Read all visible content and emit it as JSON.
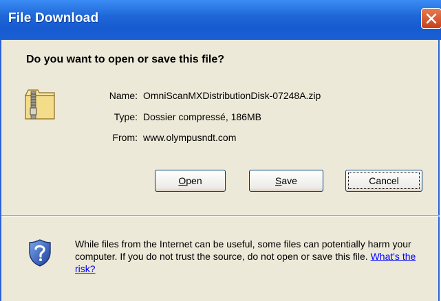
{
  "window": {
    "title": "File Download"
  },
  "dialog": {
    "question": "Do you want to open or save this file?",
    "name_label": "Name:",
    "name_value": "OmniScanMXDistributionDisk-07248A.zip",
    "type_label": "Type:",
    "type_value": "Dossier compressé, 186MB",
    "from_label": "From:",
    "from_value": "www.olympusndt.com"
  },
  "buttons": {
    "open": {
      "mnemonic": "O",
      "rest": "pen"
    },
    "save": {
      "mnemonic": "S",
      "rest": "ave"
    },
    "cancel": "Cancel"
  },
  "warning": {
    "text": "While files from the Internet can be useful, some files can potentially harm your computer. If you do not trust the source, do not open or save this file.",
    "link": "What's the risk?"
  },
  "icons": {
    "file": "zip-folder-icon",
    "security": "shield-question-icon",
    "close": "close-icon"
  },
  "colors": {
    "titlebar": "#1f67d8",
    "close_button": "#d4572a",
    "dialog_background": "#ece9d8",
    "link": "#0000ff"
  }
}
